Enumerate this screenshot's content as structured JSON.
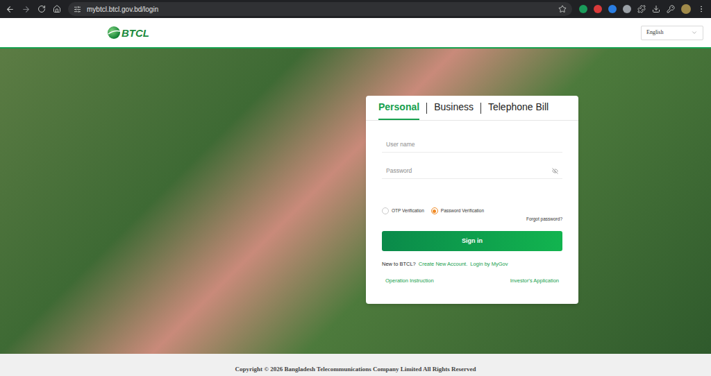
{
  "browser": {
    "url": "mybtcl.btcl.gov.bd/login"
  },
  "header": {
    "logo": "BTCL",
    "language": "English"
  },
  "login": {
    "tabs": [
      {
        "label": "Personal",
        "selected": true
      },
      {
        "label": "Business",
        "selected": false
      },
      {
        "label": "Telephone Bill",
        "selected": false
      }
    ],
    "fields": [
      {
        "placeholder": "User name",
        "kind": "text"
      },
      {
        "placeholder": "Password",
        "kind": "password"
      }
    ],
    "verification": [
      {
        "label": "OTP Verification",
        "selected": false
      },
      {
        "label": "Password Verification",
        "selected": true
      }
    ],
    "forgot": "Forgot password?",
    "submit": "Sign in",
    "signup": {
      "prompt": "New to BTCL?",
      "create": "Create New Account.",
      "mygov": "Login by MyGov"
    },
    "links": [
      "Operation Instruction",
      "Investor's Application"
    ]
  },
  "footer": "Copyright © 2026 Bangladesh Telecommunications Company Limited All Rights Reserved"
}
